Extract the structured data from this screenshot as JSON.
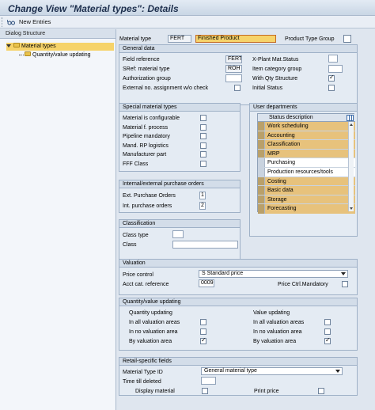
{
  "window": {
    "title": "Change View \"Material types\": Details"
  },
  "toolbar": {
    "new_entries": "New Entries"
  },
  "dialog_structure": {
    "header": "Dialog Structure",
    "items": [
      {
        "label": "Material types",
        "selected": true
      },
      {
        "label": "Quantity/value updating",
        "selected": false
      }
    ]
  },
  "header_fields": {
    "material_type_label": "Material type",
    "material_type_value": "FERT",
    "material_type_desc": "Finished Product",
    "product_type_group_label": "Product Type Group"
  },
  "general_data": {
    "title": "General data",
    "field_reference_label": "Field reference",
    "field_reference_value": "FERT",
    "sref_label": "SRef: material type",
    "sref_value": "ROH",
    "auth_group_label": "Authorization group",
    "ext_no_label": "External no. assignment w/o check",
    "xplant_label": "X-Plant Mat.Status",
    "item_cat_label": "Item category group",
    "with_qty_label": "With Qty Structure",
    "with_qty_checked": true,
    "initial_status_label": "Initial Status"
  },
  "special_material_types": {
    "title": "Special material types",
    "items": [
      {
        "label": "Material is configurable",
        "checked": false
      },
      {
        "label": "Material f. process",
        "checked": false
      },
      {
        "label": "Pipeline mandatory",
        "checked": false
      },
      {
        "label": "Mand. RP logistics",
        "checked": false
      },
      {
        "label": "Manufacturer part",
        "checked": false
      },
      {
        "label": "FFF Class",
        "checked": false
      }
    ]
  },
  "user_departments": {
    "title": "User departments",
    "column": "Status description",
    "rows": [
      {
        "label": "Work scheduling",
        "selected": true
      },
      {
        "label": "Accounting",
        "selected": true
      },
      {
        "label": "Classification",
        "selected": true
      },
      {
        "label": "MRP",
        "selected": true
      },
      {
        "label": "Purchasing",
        "selected": false
      },
      {
        "label": "Production resources/tools",
        "selected": false
      },
      {
        "label": "Costing",
        "selected": true
      },
      {
        "label": "Basic data",
        "selected": true
      },
      {
        "label": "Storage",
        "selected": true
      },
      {
        "label": "Forecasting",
        "selected": true
      }
    ]
  },
  "purchase_orders": {
    "title": "Internal/external purchase orders",
    "ext_label": "Ext. Purchase Orders",
    "ext_value": "1",
    "int_label": "Int. purchase orders",
    "int_value": "2"
  },
  "classification": {
    "title": "Classification",
    "class_type_label": "Class type",
    "class_label": "Class"
  },
  "valuation": {
    "title": "Valuation",
    "price_control_label": "Price control",
    "price_control_value": "S Standard price",
    "acct_cat_label": "Acct cat. reference",
    "acct_cat_value": "0009",
    "price_ctrl_mand_label": "Price Ctrl.Mandatory"
  },
  "qty_value_updating": {
    "title": "Quantity/value updating",
    "qty_header": "Quantity updating",
    "value_header": "Value updating",
    "rows": [
      {
        "label": "In all valuation areas",
        "qty": false,
        "value": false
      },
      {
        "label": "In no valuation area",
        "qty": false,
        "value": false
      },
      {
        "label": "By valuation area",
        "qty": true,
        "value": true
      }
    ]
  },
  "retail": {
    "title": "Retail-specific fields",
    "mat_type_id_label": "Material Type ID",
    "mat_type_id_value": "General material type",
    "time_till_deleted_label": "Time till deleted",
    "display_material_label": "Display material",
    "print_price_label": "Print price"
  }
}
